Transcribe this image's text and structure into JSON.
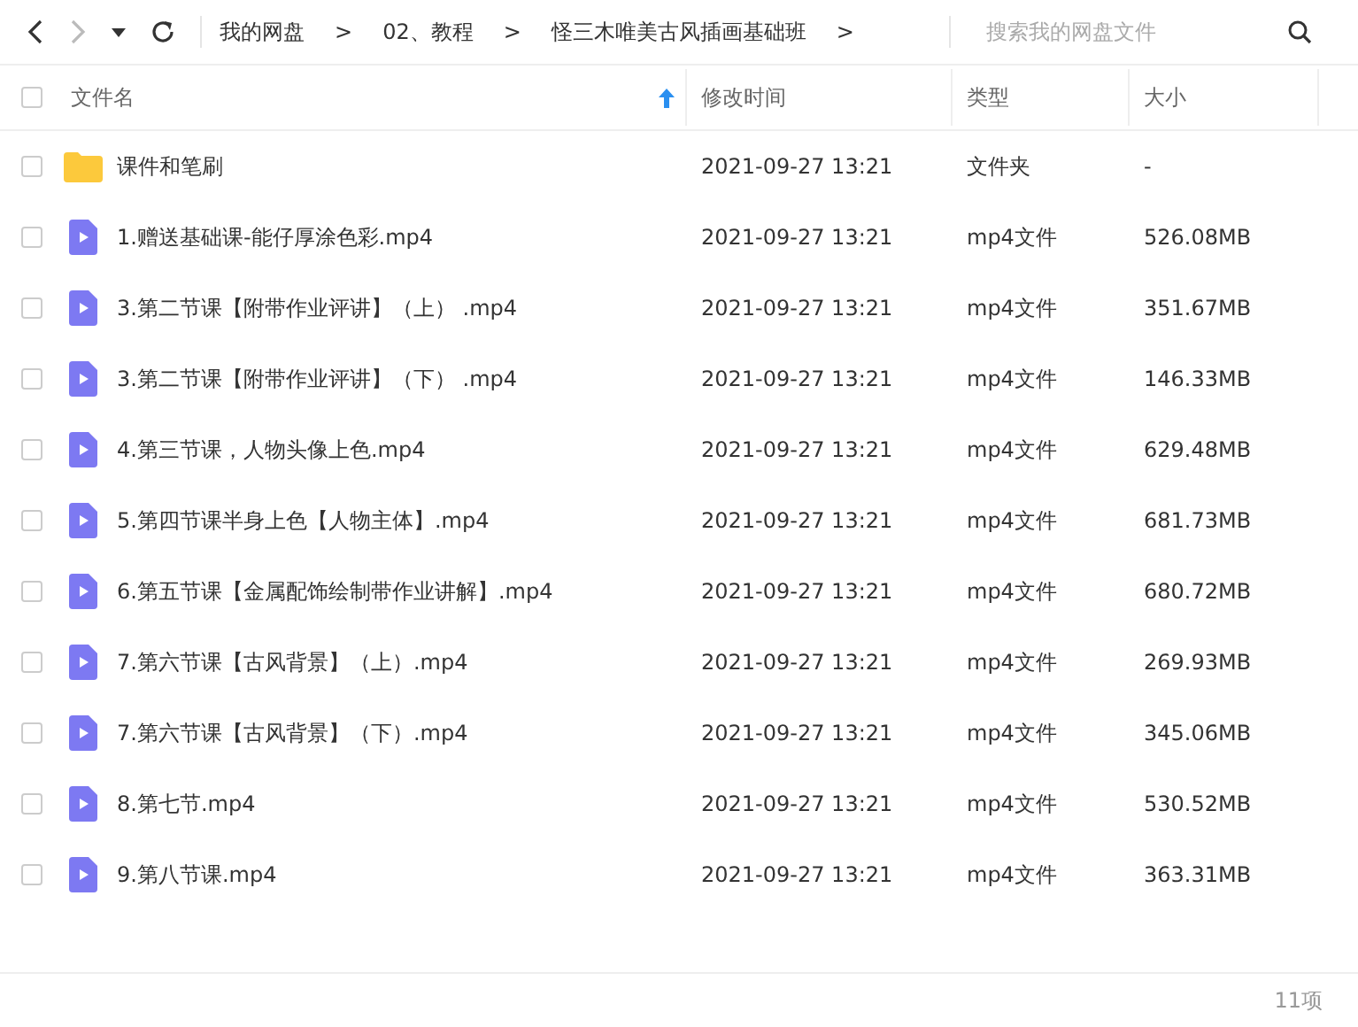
{
  "toolbar": {
    "back_disabled": false,
    "forward_disabled": true,
    "breadcrumb": [
      {
        "label": "我的网盘",
        "separator": ">"
      },
      {
        "label": "02、教程",
        "separator": ">"
      },
      {
        "label": "怪三木唯美古风插画基础班",
        "separator": ">"
      }
    ],
    "search": {
      "placeholder": "搜索我的网盘文件"
    }
  },
  "columns": [
    {
      "label": "文件名",
      "sorted": true
    },
    {
      "label": "修改时间",
      "sorted": false
    },
    {
      "label": "类型",
      "sorted": false
    },
    {
      "label": "大小",
      "sorted": false
    }
  ],
  "select_all_checked": false,
  "rows": [
    {
      "kind": "folder",
      "name": "课件和笔刷",
      "modified": "2021-09-27 13:21",
      "type": "文件夹",
      "size": "-",
      "checked": false
    },
    {
      "kind": "video",
      "name": "1.赠送基础课-能仔厚涂色彩.mp4",
      "modified": "2021-09-27 13:21",
      "type": "mp4文件",
      "size": "526.08MB",
      "checked": false
    },
    {
      "kind": "video",
      "name": "3.第二节课【附带作业评讲】（上）  .mp4",
      "modified": "2021-09-27 13:21",
      "type": "mp4文件",
      "size": "351.67MB",
      "checked": false
    },
    {
      "kind": "video",
      "name": "3.第二节课【附带作业评讲】（下）  .mp4",
      "modified": "2021-09-27 13:21",
      "type": "mp4文件",
      "size": "146.33MB",
      "checked": false
    },
    {
      "kind": "video",
      "name": "4.第三节课，人物头像上色.mp4",
      "modified": "2021-09-27 13:21",
      "type": "mp4文件",
      "size": "629.48MB",
      "checked": false
    },
    {
      "kind": "video",
      "name": "5.第四节课半身上色【人物主体】.mp4",
      "modified": "2021-09-27 13:21",
      "type": "mp4文件",
      "size": "681.73MB",
      "checked": false
    },
    {
      "kind": "video",
      "name": "6.第五节课【金属配饰绘制带作业讲解】.mp4",
      "modified": "2021-09-27 13:21",
      "type": "mp4文件",
      "size": "680.72MB",
      "checked": false
    },
    {
      "kind": "video",
      "name": "7.第六节课【古风背景】（上）.mp4",
      "modified": "2021-09-27 13:21",
      "type": "mp4文件",
      "size": "269.93MB",
      "checked": false
    },
    {
      "kind": "video",
      "name": "7.第六节课【古风背景】（下）.mp4",
      "modified": "2021-09-27 13:21",
      "type": "mp4文件",
      "size": "345.06MB",
      "checked": false
    },
    {
      "kind": "video",
      "name": "8.第七节.mp4",
      "modified": "2021-09-27 13:21",
      "type": "mp4文件",
      "size": "530.52MB",
      "checked": false
    },
    {
      "kind": "video",
      "name": "9.第八节课.mp4",
      "modified": "2021-09-27 13:21",
      "type": "mp4文件",
      "size": "363.31MB",
      "checked": false
    }
  ],
  "status_bar": {
    "count": "11项"
  }
}
